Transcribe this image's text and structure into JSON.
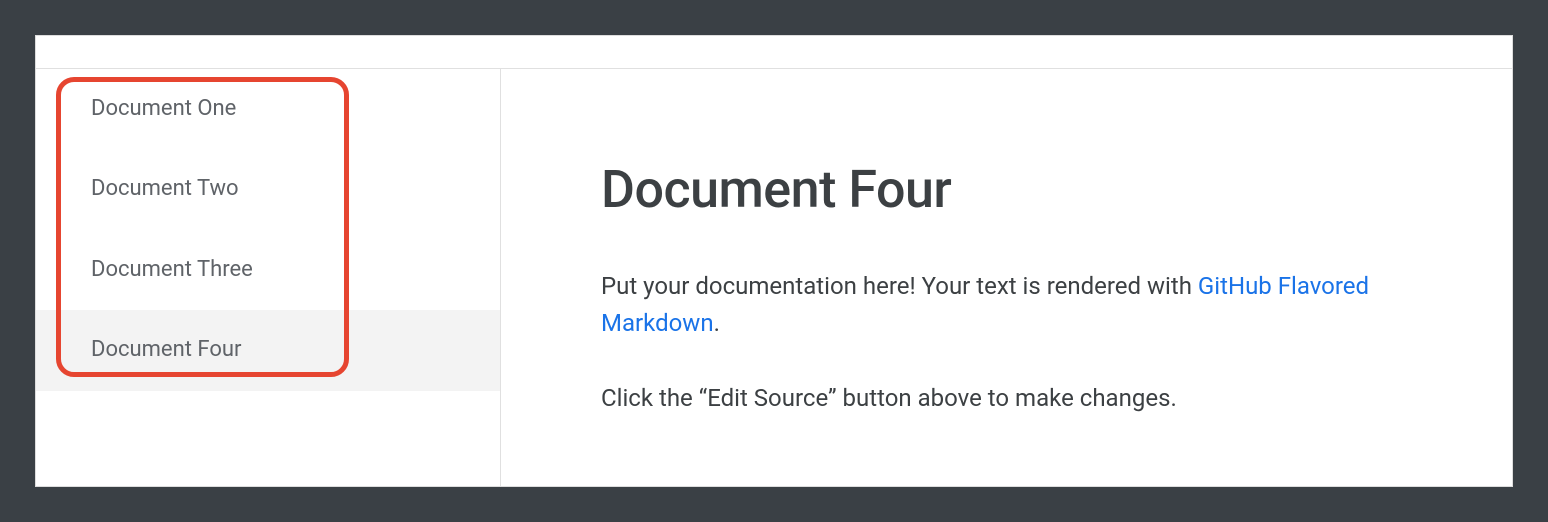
{
  "sidebar": {
    "items": [
      {
        "label": "Document One",
        "selected": false
      },
      {
        "label": "Document Two",
        "selected": false
      },
      {
        "label": "Document Three",
        "selected": false
      },
      {
        "label": "Document Four",
        "selected": true
      }
    ]
  },
  "main": {
    "title": "Document Four",
    "paragraph1_prefix": "Put your documentation here! Your text is rendered with ",
    "paragraph1_link": "GitHub Flavored Markdown",
    "paragraph1_suffix": ".",
    "paragraph2": "Click the “Edit Source” button above to make changes."
  }
}
